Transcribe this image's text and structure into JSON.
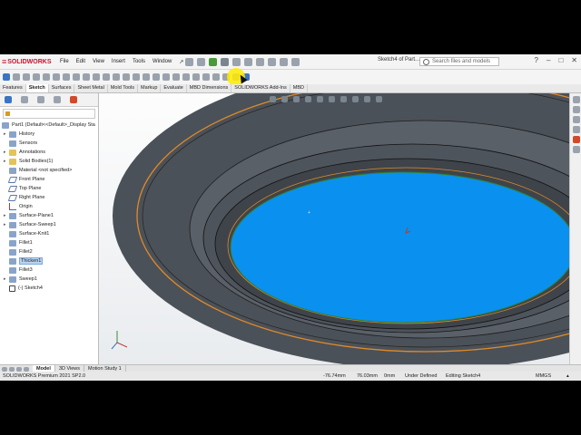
{
  "app": {
    "brand": "SOLIDWORKS",
    "document_title": "Sketch4 of Part...",
    "menus": [
      "File",
      "Edit",
      "View",
      "Insert",
      "Tools",
      "Window"
    ],
    "search_placeholder": "Search files and models"
  },
  "command_tabs": [
    "Features",
    "Sketch",
    "Surfaces",
    "Sheet Metal",
    "Mold Tools",
    "Markup",
    "Evaluate",
    "MBD Dimensions",
    "SOLIDWORKS Add-Ins",
    "MBD"
  ],
  "active_command_tab": "Sketch",
  "tree": {
    "root": "Part1  (Default<<Default>_Display Sta",
    "items": [
      "History",
      "Sensors",
      "Annotations",
      "Solid Bodies(1)",
      "Material <not specified>",
      "Front Plane",
      "Top Plane",
      "Right Plane",
      "Origin",
      "Surface-Plane1",
      "Surface-Sweep1",
      "Surface-Knit1",
      "Fillet1",
      "Fillet2",
      "Thicken1",
      "Fillet3",
      "Sweep1",
      "(-) Sketch4"
    ],
    "selected": "Thicken1"
  },
  "bottom_tabs": [
    "Model",
    "3D Views",
    "Motion Study 1"
  ],
  "active_bottom_tab": "Model",
  "status": {
    "product": "SOLIDWORKS Premium 2021 SP2.0",
    "x": "-76.74mm",
    "y": "76.03mm",
    "z": "0mm",
    "state": "Under Defined",
    "mode": "Editing Sketch4",
    "units": "MMGS"
  },
  "colors": {
    "sketch_face": "#0a90ee",
    "part_body": "#4b5158",
    "edge_highlight": "#e08a2a",
    "selection_yellow": "#ffeb00"
  }
}
